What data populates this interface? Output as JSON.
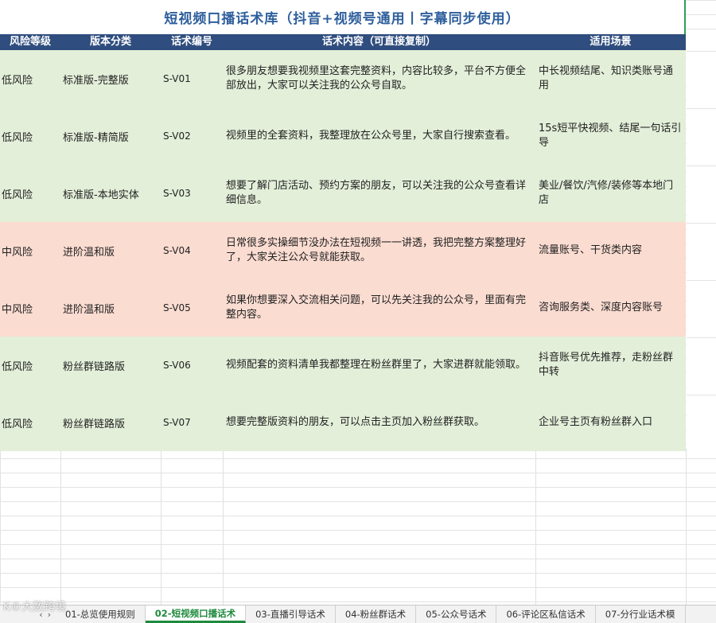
{
  "title": "短视频口播话术库（抖音+视频号通用丨字幕同步使用）",
  "headers": [
    "风险等级",
    "版本分类",
    "话术编号",
    "话术内容（可直接复制）",
    "适用场景"
  ],
  "rows": [
    {
      "risk": "低风险",
      "category": "标准版-完整版",
      "code": "S-V01",
      "content": "很多朋友想要我视频里这套完整资料，内容比较多，平台不方便全部放出，大家可以关注我的公众号自取。",
      "scene": "中长视频结尾、知识类账号通用",
      "tone": "green"
    },
    {
      "risk": "低风险",
      "category": "标准版-精简版",
      "code": "S-V02",
      "content": "视频里的全套资料，我整理放在公众号里，大家自行搜索查看。",
      "scene": "15s短平快视频、结尾一句话引导",
      "tone": "green"
    },
    {
      "risk": "低风险",
      "category": "标准版-本地实体",
      "code": "S-V03",
      "content": "想要了解门店活动、预约方案的朋友，可以关注我的公众号查看详细信息。",
      "scene": "美业/餐饮/汽修/装修等本地门店",
      "tone": "green"
    },
    {
      "risk": "中风险",
      "category": "进阶温和版",
      "code": "S-V04",
      "content": "日常很多实操细节没办法在短视频一一讲透，我把完整方案整理好了，大家关注公众号就能获取。",
      "scene": "流量账号、干货类内容",
      "tone": "pink"
    },
    {
      "risk": "中风险",
      "category": "进阶温和版",
      "code": "S-V05",
      "content": "如果你想要深入交流相关问题，可以先关注我的公众号，里面有完整内容。",
      "scene": "咨询服务类、深度内容账号",
      "tone": "pink"
    },
    {
      "risk": "低风险",
      "category": "粉丝群链路版",
      "code": "S-V06",
      "content": "视频配套的资料清单我都整理在粉丝群里了，大家进群就能领取。",
      "scene": "抖音账号优先推荐，走粉丝群中转",
      "tone": "green"
    },
    {
      "risk": "低风险",
      "category": "粉丝群链路版",
      "code": "S-V07",
      "content": "想要完整版资料的朋友，可以点击主页加入粉丝群获取。",
      "scene": "企业号主页有粉丝群入口",
      "tone": "green"
    }
  ],
  "tabs": [
    "01-总览使用规则",
    "02-短视频口播话术",
    "03-直播引导话术",
    "04-粉丝群话术",
    "05-公众号话术",
    "06-评论区私信话术",
    "07-分行业话术模"
  ],
  "active_tab": 1,
  "nav": {
    "prev": "‹",
    "next": "›"
  },
  "watermark": "K©大数跨境"
}
